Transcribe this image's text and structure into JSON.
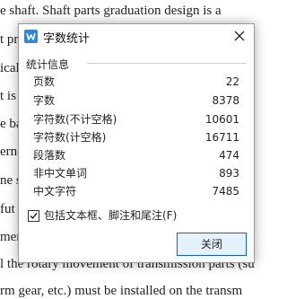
{
  "document": {
    "lines": [
      "e shaft. Shaft parts graduation design is a",
      "t     proc      requ              majori",
      "ical    ncy.    sser              plan",
      "t is     rten     ter             prehe",
      "e ba                              skil",
      "erne                              pro",
      "ne so                             signi",
      "  fut                             ure",
      "ment                              of the",
      "l the rotary movement of transmission parts (su",
      "rm gear, etc.) must be installed on the transm"
    ]
  },
  "dialog": {
    "title": "字数统计",
    "section_title": "统计信息",
    "stats": [
      {
        "label": "页数",
        "value": "22"
      },
      {
        "label": "字数",
        "value": "8378"
      },
      {
        "label": "字符数(不计空格)",
        "value": "10601"
      },
      {
        "label": "字符数(计空格)",
        "value": "16711"
      },
      {
        "label": "段落数",
        "value": "474"
      },
      {
        "label": "非中文单词",
        "value": "893"
      },
      {
        "label": "中文字符",
        "value": "7485"
      }
    ],
    "include_checkbox": {
      "label": "包括文本框、脚注和尾注(F)",
      "checked": true
    },
    "close_button_label": "关闭",
    "close_icon": "close-icon",
    "app_icon": "wps-writer-icon"
  },
  "colors": {
    "accent": "#0a64c8",
    "app_icon": "#2b86e2"
  }
}
